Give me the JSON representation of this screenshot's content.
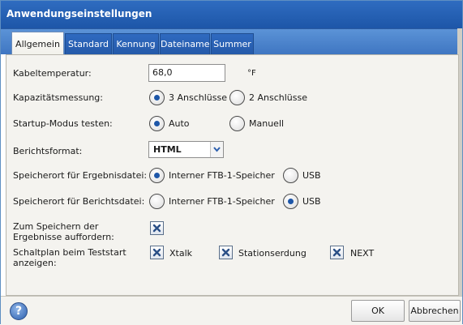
{
  "window": {
    "title": "Anwendungseinstellungen"
  },
  "tabs": [
    {
      "label": "Allgemein",
      "active": true
    },
    {
      "label": "Standard",
      "active": false
    },
    {
      "label": "Kennung",
      "active": false
    },
    {
      "label": "Dateiname",
      "active": false
    },
    {
      "label": "Summer",
      "active": false
    }
  ],
  "settings": {
    "cable_temperature": {
      "label": "Kabeltemperatur:",
      "value": "68,0",
      "unit": "°F"
    },
    "capacitance": {
      "label": "Kapazitätsmessung:",
      "options": [
        "3 Anschlüsse",
        "2 Anschlüsse"
      ],
      "selected": "3 Anschlüsse"
    },
    "startup_mode": {
      "label": "Startup-Modus testen:",
      "options": [
        "Auto",
        "Manuell"
      ],
      "selected": "Auto"
    },
    "report_format": {
      "label": "Berichtsformat:",
      "value": "HTML"
    },
    "result_location": {
      "label": "Speicherort für Ergebnisdatei:",
      "options": [
        "Interner FTB-1-Speicher",
        "USB"
      ],
      "selected": "Interner FTB-1-Speicher"
    },
    "report_location": {
      "label": "Speicherort für Berichtsdatei:",
      "options": [
        "Interner FTB-1-Speicher",
        "USB"
      ],
      "selected": "USB"
    },
    "prompt_save": {
      "label_line1": "Zum Speichern der",
      "label_line2": "Ergebnisse auffordern:",
      "checked": true
    },
    "wiring_diagram": {
      "label_line1": "Schaltplan beim Teststart",
      "label_line2": "anzeigen:",
      "items": [
        {
          "label": "Xtalk",
          "checked": true
        },
        {
          "label": "Stationserdung",
          "checked": true
        },
        {
          "label": "NEXT",
          "checked": true
        }
      ]
    }
  },
  "footer": {
    "help_icon": "?",
    "ok_label": "OK",
    "cancel_label": "Abbrechen"
  },
  "colors": {
    "title_bar": "#1d56a8",
    "tab_strip": "#4f86cf",
    "panel": "#f4f3ef",
    "radio_dot": "#1d56a8"
  }
}
